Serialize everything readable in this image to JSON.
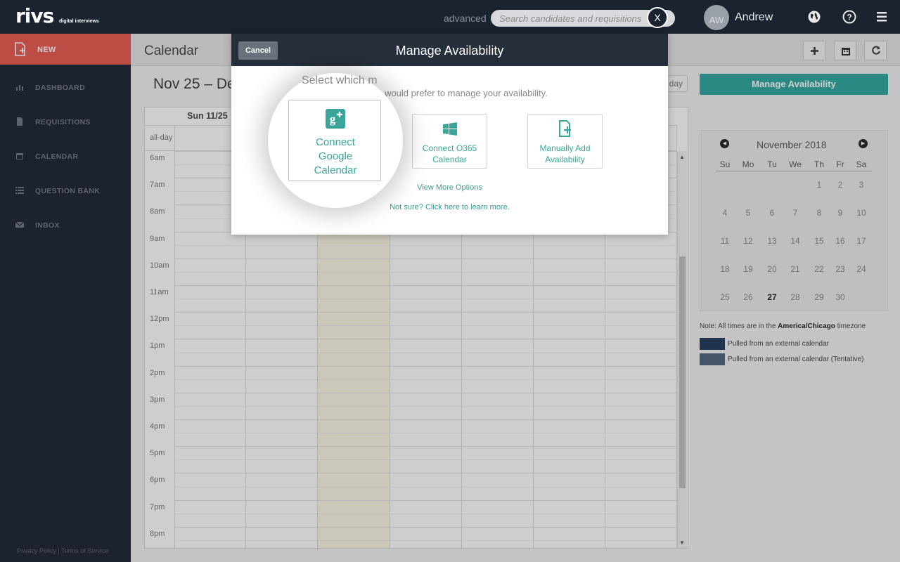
{
  "app": {
    "logo": "rivs",
    "logo_sub": "digital interviews"
  },
  "topbar": {
    "advanced_label": "advanced",
    "search_placeholder": "Search candidates and requisitions",
    "avatar_initials": "AW",
    "username": "Andrew",
    "icons": [
      "globe-icon",
      "help-icon",
      "menu-icon"
    ]
  },
  "sidebar": {
    "new_label": "NEW",
    "items": [
      {
        "label": "DASHBOARD",
        "icon": "bar-chart-icon"
      },
      {
        "label": "REQUISITIONS",
        "icon": "document-icon"
      },
      {
        "label": "CALENDAR",
        "icon": "calendar-icon"
      },
      {
        "label": "QUESTION BANK",
        "icon": "list-icon"
      },
      {
        "label": "INBOX",
        "icon": "envelope-icon"
      }
    ],
    "footer": "Privacy Policy | Terms of Service"
  },
  "main": {
    "title": "Calendar",
    "range_title": "Nov 25 – De",
    "today_label": "day",
    "manage_button": "Manage Availability",
    "column_header": "Sun 11/25",
    "allday_label": "all-day",
    "times": [
      "6am",
      "7am",
      "8am",
      "9am",
      "10am",
      "11am",
      "12pm",
      "1pm",
      "2pm",
      "3pm",
      "4pm",
      "5pm",
      "6pm",
      "7pm",
      "8pm"
    ]
  },
  "mini_calendar": {
    "month": "November 2018",
    "dow": [
      "Su",
      "Mo",
      "Tu",
      "We",
      "Th",
      "Fr",
      "Sa"
    ],
    "weeks": [
      [
        "",
        "",
        "",
        "",
        "1",
        "2",
        "3"
      ],
      [
        "4",
        "5",
        "6",
        "7",
        "8",
        "9",
        "10"
      ],
      [
        "11",
        "12",
        "13",
        "14",
        "15",
        "16",
        "17"
      ],
      [
        "18",
        "19",
        "20",
        "21",
        "22",
        "23",
        "24"
      ],
      [
        "25",
        "26",
        "27",
        "28",
        "29",
        "30",
        ""
      ]
    ],
    "today": "27"
  },
  "notes": {
    "timezone_prefix": "Note: All times are in the",
    "timezone": "America/Chicago",
    "timezone_suffix": "timezone",
    "legend": [
      {
        "label": "Pulled from an external calendar",
        "color": "#1f3a56"
      },
      {
        "label": "Pulled from an external calendar (Tentative)",
        "color": "#4e6479"
      }
    ]
  },
  "modal": {
    "title": "Manage Availability",
    "cancel_label": "Cancel",
    "subtitle_left": "Select which m",
    "subtitle_right": "od you would prefer to manage your availability.",
    "google": {
      "line1": "Connect",
      "line2": "Google",
      "line3": "Calendar"
    },
    "o365": {
      "line1": "Connect O365",
      "line2": "Calendar"
    },
    "manual": {
      "line1": "Manually Add",
      "line2": "Availability"
    },
    "view_more": "View More Options",
    "not_sure": "Not sure? Click here to learn more.",
    "close_label": "X"
  },
  "colors": {
    "accent": "#2ea79c",
    "new_button": "#e8594c",
    "nav_bg": "#1c2330",
    "today_bg": "#fcf8e3"
  }
}
